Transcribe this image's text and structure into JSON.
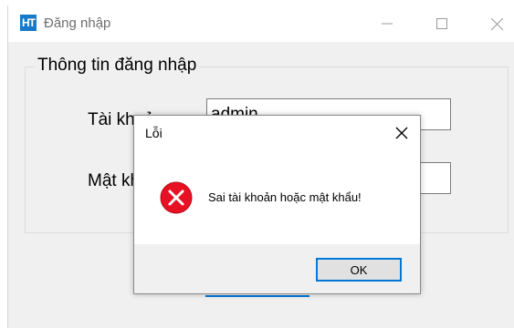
{
  "window": {
    "app_icon_text": "HT",
    "title": "Đăng nhập"
  },
  "login_form": {
    "group_title": "Thông tin đăng nhập",
    "account_label": "Tài khoản:",
    "account_value": "admin",
    "password_label": "Mật khẩu:",
    "password_value": ""
  },
  "dialog": {
    "title": "Lỗi",
    "message": "Sai tài khoản hoặc mật khẩu!",
    "ok_label": "OK"
  },
  "colors": {
    "accent": "#0078d7",
    "error_icon": "#e81123",
    "app_icon_bg": "#1679c9"
  },
  "icons": {
    "minimize": "minimize-icon",
    "maximize": "maximize-icon",
    "close": "close-icon",
    "error": "error-icon"
  }
}
